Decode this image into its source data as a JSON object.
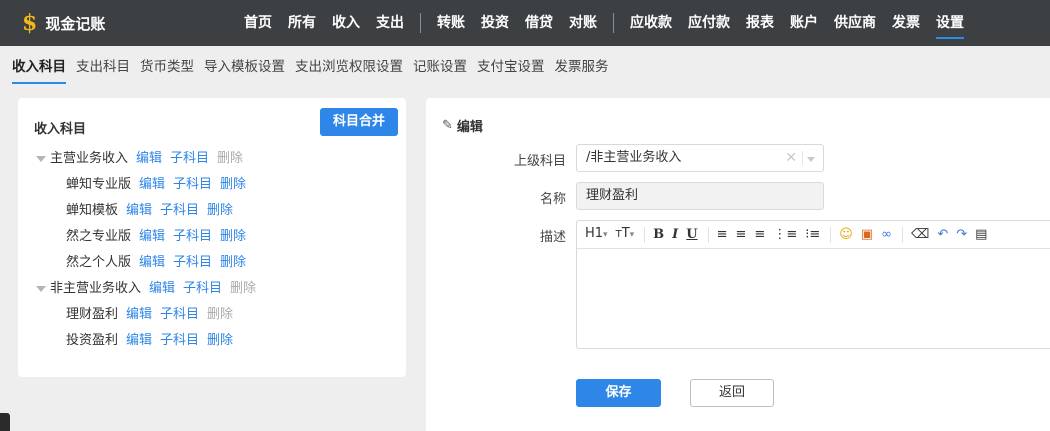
{
  "app": {
    "logo_symbol": "$",
    "title": "现金记账"
  },
  "nav": {
    "group1": [
      "首页",
      "所有",
      "收入",
      "支出"
    ],
    "group2": [
      "转账",
      "投资",
      "借贷",
      "对账"
    ],
    "group3": [
      "应收款",
      "应付款",
      "报表",
      "账户",
      "供应商",
      "发票",
      "设置"
    ],
    "active": "设置"
  },
  "subtabs": [
    "收入科目",
    "支出科目",
    "货币类型",
    "导入模板设置",
    "支出浏览权限设置",
    "记账设置",
    "支付宝设置",
    "发票服务"
  ],
  "left": {
    "title": "收入科目",
    "merge_label": "科目合并",
    "tree": [
      {
        "label": "主营业务收入",
        "level": 0,
        "delete_disabled": true
      },
      {
        "label": "蝉知专业版",
        "level": 1,
        "delete_disabled": false
      },
      {
        "label": "蝉知模板",
        "level": 1,
        "delete_disabled": false
      },
      {
        "label": "然之专业版",
        "level": 1,
        "delete_disabled": false
      },
      {
        "label": "然之个人版",
        "level": 1,
        "delete_disabled": false
      },
      {
        "label": "非主营业务收入",
        "level": 0,
        "delete_disabled": true
      },
      {
        "label": "理财盈利",
        "level": 1,
        "delete_disabled": true
      },
      {
        "label": "投资盈利",
        "level": 1,
        "delete_disabled": false
      }
    ],
    "actions": {
      "edit": "编辑",
      "child": "子科目",
      "delete": "删除"
    }
  },
  "right": {
    "heading": "编辑",
    "parent_label": "上级科目",
    "parent_value": "/非主营业务收入",
    "name_label": "名称",
    "name_value": "理财盈利",
    "desc_label": "描述",
    "save_label": "保存",
    "back_label": "返回"
  },
  "colors": {
    "topbar": "#3c4043",
    "accent": "#2e86e8",
    "logo": "#f5b81b"
  }
}
